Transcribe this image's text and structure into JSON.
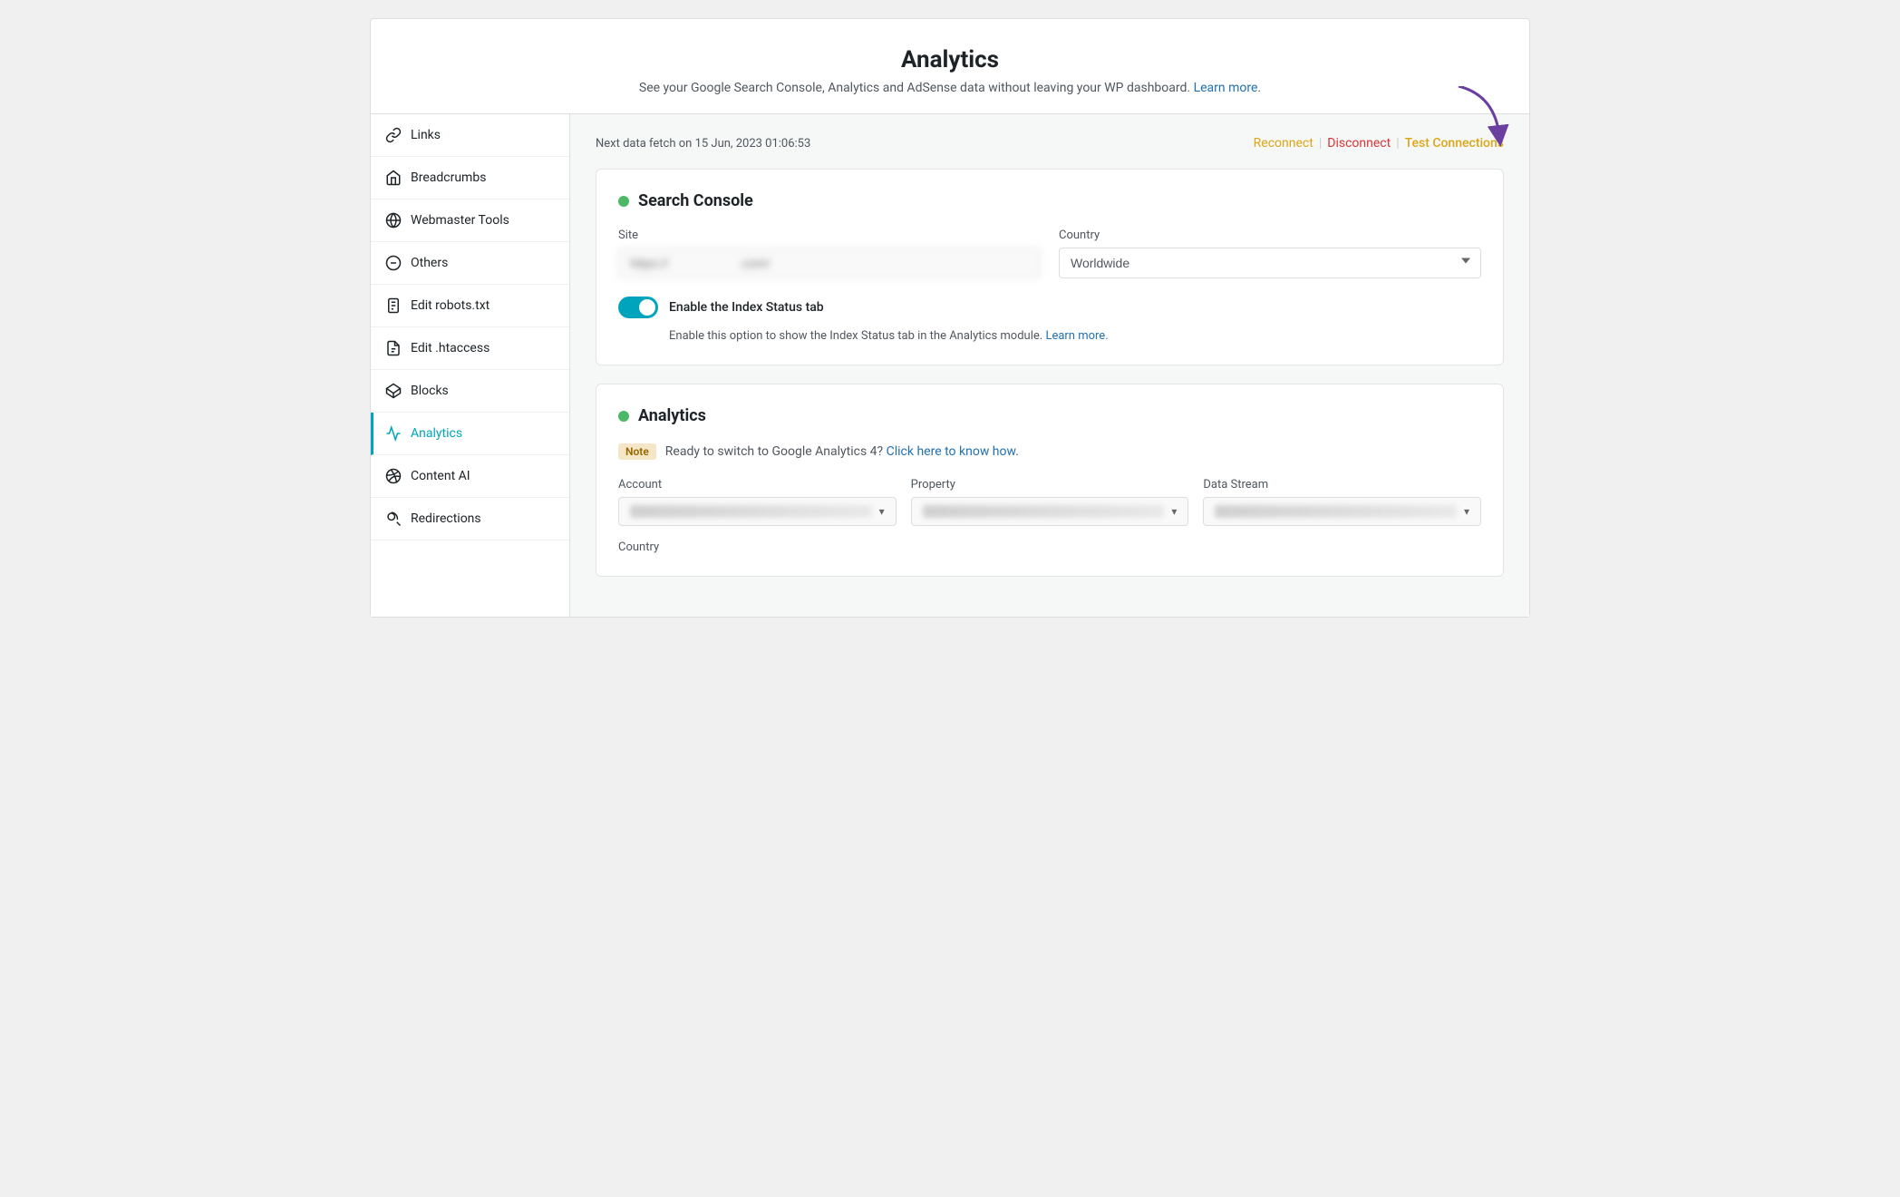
{
  "page": {
    "title": "Analytics",
    "description": "See your Google Search Console, Analytics and AdSense data without leaving your WP dashboard.",
    "learn_more_label": "Learn more",
    "next_fetch": "Next data fetch on 15 Jun, 2023 01:06:53"
  },
  "actions": {
    "reconnect": "Reconnect",
    "disconnect": "Disconnect",
    "test_connections": "Test Connections",
    "separator": "|"
  },
  "sidebar": {
    "items": [
      {
        "id": "links",
        "label": "Links"
      },
      {
        "id": "breadcrumbs",
        "label": "Breadcrumbs"
      },
      {
        "id": "webmaster-tools",
        "label": "Webmaster Tools"
      },
      {
        "id": "others",
        "label": "Others"
      },
      {
        "id": "edit-robots",
        "label": "Edit robots.txt"
      },
      {
        "id": "edit-htaccess",
        "label": "Edit .htaccess"
      },
      {
        "id": "blocks",
        "label": "Blocks"
      },
      {
        "id": "analytics",
        "label": "Analytics",
        "active": true
      },
      {
        "id": "content-ai",
        "label": "Content AI"
      },
      {
        "id": "redirections",
        "label": "Redirections"
      }
    ]
  },
  "search_console": {
    "title": "Search Console",
    "status": "active",
    "site_label": "Site",
    "site_placeholder": "https://                    .com/",
    "country_label": "Country",
    "country_value": "Worldwide",
    "toggle_label": "Enable the Index Status tab",
    "toggle_on": true,
    "toggle_description": "Enable this option to show the Index Status tab in the Analytics module.",
    "toggle_learn_more": "Learn more."
  },
  "analytics": {
    "title": "Analytics",
    "status": "active",
    "note_label": "Note",
    "note_text": "Ready to switch to Google Analytics 4?",
    "note_link_text": "Click here to know how",
    "account_label": "Account",
    "property_label": "Property",
    "data_stream_label": "Data Stream",
    "country_label": "Country"
  }
}
